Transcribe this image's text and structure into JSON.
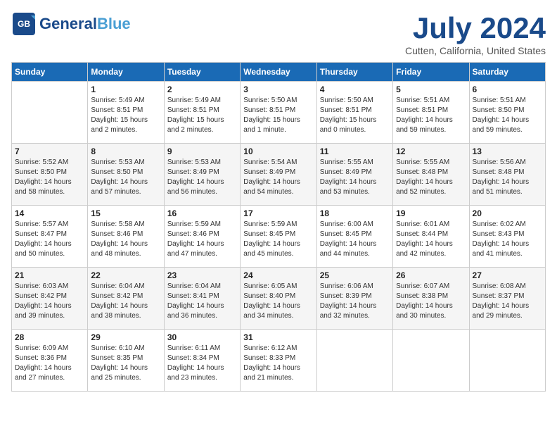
{
  "header": {
    "logo": {
      "part1": "General",
      "part2": "Blue",
      "tagline": ""
    },
    "title": "July 2024",
    "location": "Cutten, California, United States"
  },
  "weekdays": [
    "Sunday",
    "Monday",
    "Tuesday",
    "Wednesday",
    "Thursday",
    "Friday",
    "Saturday"
  ],
  "weeks": [
    [
      {
        "day": "",
        "info": ""
      },
      {
        "day": "1",
        "info": "Sunrise: 5:49 AM\nSunset: 8:51 PM\nDaylight: 15 hours\nand 2 minutes."
      },
      {
        "day": "2",
        "info": "Sunrise: 5:49 AM\nSunset: 8:51 PM\nDaylight: 15 hours\nand 2 minutes."
      },
      {
        "day": "3",
        "info": "Sunrise: 5:50 AM\nSunset: 8:51 PM\nDaylight: 15 hours\nand 1 minute."
      },
      {
        "day": "4",
        "info": "Sunrise: 5:50 AM\nSunset: 8:51 PM\nDaylight: 15 hours\nand 0 minutes."
      },
      {
        "day": "5",
        "info": "Sunrise: 5:51 AM\nSunset: 8:51 PM\nDaylight: 14 hours\nand 59 minutes."
      },
      {
        "day": "6",
        "info": "Sunrise: 5:51 AM\nSunset: 8:50 PM\nDaylight: 14 hours\nand 59 minutes."
      }
    ],
    [
      {
        "day": "7",
        "info": "Sunrise: 5:52 AM\nSunset: 8:50 PM\nDaylight: 14 hours\nand 58 minutes."
      },
      {
        "day": "8",
        "info": "Sunrise: 5:53 AM\nSunset: 8:50 PM\nDaylight: 14 hours\nand 57 minutes."
      },
      {
        "day": "9",
        "info": "Sunrise: 5:53 AM\nSunset: 8:49 PM\nDaylight: 14 hours\nand 56 minutes."
      },
      {
        "day": "10",
        "info": "Sunrise: 5:54 AM\nSunset: 8:49 PM\nDaylight: 14 hours\nand 54 minutes."
      },
      {
        "day": "11",
        "info": "Sunrise: 5:55 AM\nSunset: 8:49 PM\nDaylight: 14 hours\nand 53 minutes."
      },
      {
        "day": "12",
        "info": "Sunrise: 5:55 AM\nSunset: 8:48 PM\nDaylight: 14 hours\nand 52 minutes."
      },
      {
        "day": "13",
        "info": "Sunrise: 5:56 AM\nSunset: 8:48 PM\nDaylight: 14 hours\nand 51 minutes."
      }
    ],
    [
      {
        "day": "14",
        "info": "Sunrise: 5:57 AM\nSunset: 8:47 PM\nDaylight: 14 hours\nand 50 minutes."
      },
      {
        "day": "15",
        "info": "Sunrise: 5:58 AM\nSunset: 8:46 PM\nDaylight: 14 hours\nand 48 minutes."
      },
      {
        "day": "16",
        "info": "Sunrise: 5:59 AM\nSunset: 8:46 PM\nDaylight: 14 hours\nand 47 minutes."
      },
      {
        "day": "17",
        "info": "Sunrise: 5:59 AM\nSunset: 8:45 PM\nDaylight: 14 hours\nand 45 minutes."
      },
      {
        "day": "18",
        "info": "Sunrise: 6:00 AM\nSunset: 8:45 PM\nDaylight: 14 hours\nand 44 minutes."
      },
      {
        "day": "19",
        "info": "Sunrise: 6:01 AM\nSunset: 8:44 PM\nDaylight: 14 hours\nand 42 minutes."
      },
      {
        "day": "20",
        "info": "Sunrise: 6:02 AM\nSunset: 8:43 PM\nDaylight: 14 hours\nand 41 minutes."
      }
    ],
    [
      {
        "day": "21",
        "info": "Sunrise: 6:03 AM\nSunset: 8:42 PM\nDaylight: 14 hours\nand 39 minutes."
      },
      {
        "day": "22",
        "info": "Sunrise: 6:04 AM\nSunset: 8:42 PM\nDaylight: 14 hours\nand 38 minutes."
      },
      {
        "day": "23",
        "info": "Sunrise: 6:04 AM\nSunset: 8:41 PM\nDaylight: 14 hours\nand 36 minutes."
      },
      {
        "day": "24",
        "info": "Sunrise: 6:05 AM\nSunset: 8:40 PM\nDaylight: 14 hours\nand 34 minutes."
      },
      {
        "day": "25",
        "info": "Sunrise: 6:06 AM\nSunset: 8:39 PM\nDaylight: 14 hours\nand 32 minutes."
      },
      {
        "day": "26",
        "info": "Sunrise: 6:07 AM\nSunset: 8:38 PM\nDaylight: 14 hours\nand 30 minutes."
      },
      {
        "day": "27",
        "info": "Sunrise: 6:08 AM\nSunset: 8:37 PM\nDaylight: 14 hours\nand 29 minutes."
      }
    ],
    [
      {
        "day": "28",
        "info": "Sunrise: 6:09 AM\nSunset: 8:36 PM\nDaylight: 14 hours\nand 27 minutes."
      },
      {
        "day": "29",
        "info": "Sunrise: 6:10 AM\nSunset: 8:35 PM\nDaylight: 14 hours\nand 25 minutes."
      },
      {
        "day": "30",
        "info": "Sunrise: 6:11 AM\nSunset: 8:34 PM\nDaylight: 14 hours\nand 23 minutes."
      },
      {
        "day": "31",
        "info": "Sunrise: 6:12 AM\nSunset: 8:33 PM\nDaylight: 14 hours\nand 21 minutes."
      },
      {
        "day": "",
        "info": ""
      },
      {
        "day": "",
        "info": ""
      },
      {
        "day": "",
        "info": ""
      }
    ]
  ]
}
